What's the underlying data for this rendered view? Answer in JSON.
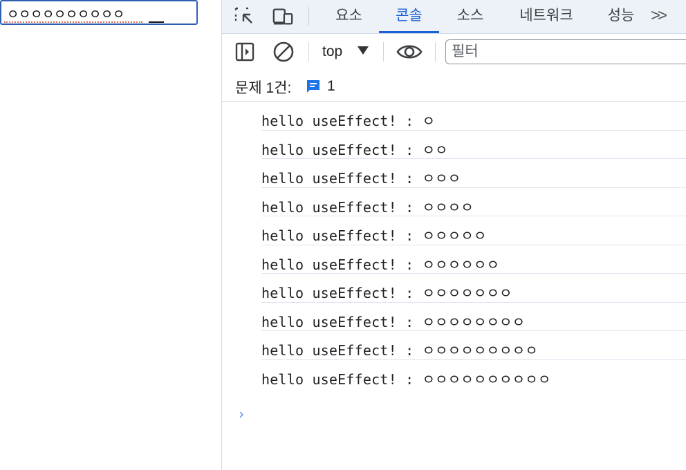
{
  "page": {
    "input_value": "ㅇㅇㅇㅇㅇㅇㅇㅇㅇㅇ"
  },
  "devtools": {
    "tabs": [
      {
        "label": "요소"
      },
      {
        "label": "콘솔"
      },
      {
        "label": "소스"
      },
      {
        "label": "네트워크"
      },
      {
        "label": "성능"
      }
    ],
    "active_tab": "콘솔",
    "more_label": ">>",
    "toolbar": {
      "context": "top",
      "filter_placeholder": "필터"
    },
    "issues": {
      "label": "문제 1건:",
      "count": "1"
    },
    "console_logs": [
      "hello useEffect! : ㅇ",
      "hello useEffect! : ㅇㅇ",
      "hello useEffect! : ㅇㅇㅇ",
      "hello useEffect! : ㅇㅇㅇㅇ",
      "hello useEffect! : ㅇㅇㅇㅇㅇ",
      "hello useEffect! : ㅇㅇㅇㅇㅇㅇ",
      "hello useEffect! : ㅇㅇㅇㅇㅇㅇㅇ",
      "hello useEffect! : ㅇㅇㅇㅇㅇㅇㅇㅇ",
      "hello useEffect! : ㅇㅇㅇㅇㅇㅇㅇㅇㅇ",
      "hello useEffect! : ㅇㅇㅇㅇㅇㅇㅇㅇㅇㅇ"
    ],
    "prompt_symbol": "›",
    "colors": {
      "accent": "#1a5fd6",
      "issue_icon": "#1a73e8"
    }
  }
}
